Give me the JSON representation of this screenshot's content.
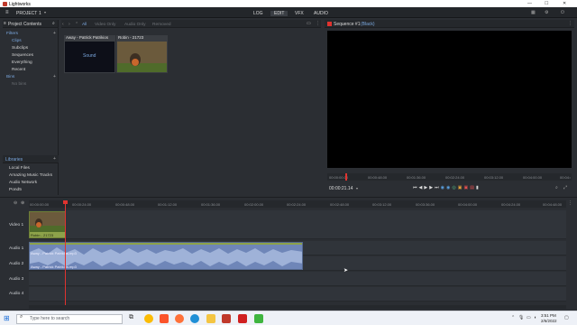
{
  "window": {
    "title": "Lightworks"
  },
  "menubar": {
    "project_label": "PROJECT",
    "project_number": "1",
    "tabs": [
      "LOG",
      "EDIT",
      "VFX",
      "AUDIO"
    ],
    "active_tab": "EDIT"
  },
  "left_panel": {
    "header": "Project Contents",
    "filters_label": "Filters",
    "filter_items": [
      "Clips",
      "Subclips",
      "Sequences",
      "Everything",
      "Recent"
    ],
    "bins_label": "Bins",
    "bins_items": [
      "No bins"
    ],
    "libraries_label": "Libraries",
    "library_items": [
      "Local Files",
      "Amazing Music Tracks",
      "Audio Network",
      "Pond5"
    ]
  },
  "media_panel": {
    "filter_tabs": [
      "All",
      "Video Only",
      "Audio Only",
      "Removed"
    ],
    "active_filter": "All",
    "clips": [
      {
        "title": "Away - Patrick Patrikios",
        "kind_text": "Sound"
      },
      {
        "title": "Robin - 21723",
        "kind_text": ""
      }
    ]
  },
  "viewer": {
    "title": "Sequence #1",
    "subtitle": "(Black)",
    "ruler_ticks": [
      "00:00:00.00",
      "00:00:48.00",
      "00:01:36.00",
      "00:02:24.00",
      "00:03:12.00",
      "00:04:00.00",
      "00:04:48.00"
    ],
    "timecode": "00:00:21.14"
  },
  "timeline": {
    "ruler_ticks": [
      "00:00:00.00",
      "00:00:24.00",
      "00:00:48.00",
      "00:01:12.00",
      "00:01:36.00",
      "00:02:00.00",
      "00:02:24.00",
      "00:02:48.00",
      "00:03:12.00",
      "00:03:36.00",
      "00:04:00.00",
      "00:04:24.00",
      "00:04:48.00"
    ],
    "tracks": [
      "Video 1",
      "Audio 1",
      "Audio 2",
      "Audio 3",
      "Audio 4"
    ],
    "video_clip_label": "Robin - 21723",
    "audio_clip_label_1": "Away - Patrick Patrikios.mp3",
    "audio_clip_label_2": "Away - Patrick Patrikios.mp3"
  },
  "taskbar": {
    "search_placeholder": "Type here to search",
    "time": "3:51 PM",
    "date": "2/6/2022"
  },
  "colors": {
    "accent": "#7aa7de",
    "playhead": "#e0332f",
    "audio_clip": "#6f86b8",
    "video_clip": "#8da24a"
  }
}
